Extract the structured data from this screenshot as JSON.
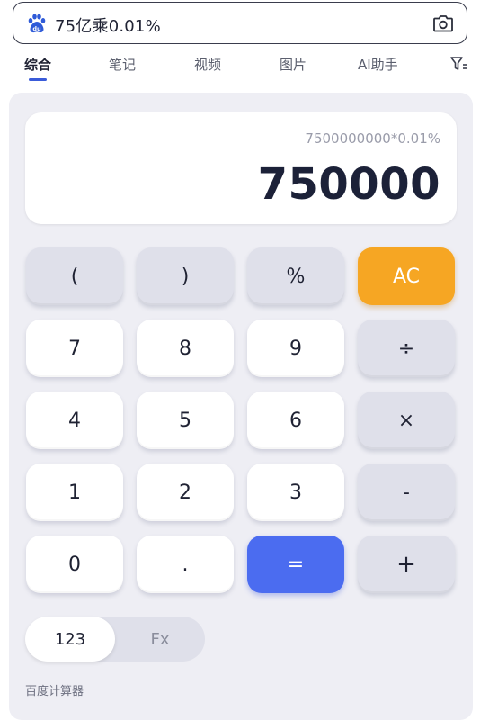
{
  "search": {
    "query": "75亿乘0.01%"
  },
  "tabs": [
    {
      "label": "综合",
      "active": true
    },
    {
      "label": "笔记",
      "active": false
    },
    {
      "label": "视频",
      "active": false
    },
    {
      "label": "图片",
      "active": false
    },
    {
      "label": "AI助手",
      "active": false
    }
  ],
  "calculator": {
    "expression": "7500000000*0.01%",
    "result": "750000",
    "keys": {
      "open_paren": "(",
      "close_paren": ")",
      "percent": "%",
      "ac": "AC",
      "k7": "7",
      "k8": "8",
      "k9": "9",
      "divide": "÷",
      "k4": "4",
      "k5": "5",
      "k6": "6",
      "multiply": "×",
      "k1": "1",
      "k2": "2",
      "k3": "3",
      "minus": "-",
      "k0": "0",
      "dot": ".",
      "equals": "=",
      "plus": "+"
    },
    "mode": {
      "basic": "123",
      "scientific": "Fx"
    },
    "source_label": "百度计算器"
  },
  "colors": {
    "accent_orange": "#f6a623",
    "accent_blue": "#4b6cf0",
    "tab_underline": "#3a5bd9"
  },
  "icons": [
    "baidu-paw-icon",
    "camera-icon",
    "filter-icon"
  ]
}
